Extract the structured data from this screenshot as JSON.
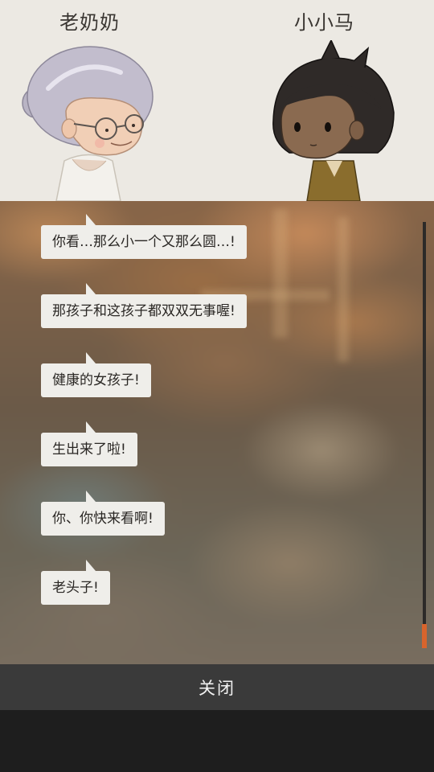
{
  "characters": {
    "left_name": "老奶奶",
    "right_name": "小小马"
  },
  "dialog": [
    "你看…那么小一个又那么圆…!",
    "那孩子和这孩子都双双无事喔!",
    "健康的女孩子!",
    "生出来了啦!",
    "你、你快来看啊!",
    "老头子!"
  ],
  "close_button": "关闭",
  "colors": {
    "header_bg": "#ece9e3",
    "bubble_bg": "#efeeea",
    "close_bar_bg": "#3a3a3a",
    "scroll_thumb": "#d8642c"
  },
  "icons": {
    "grandma_portrait": "grandma-portrait",
    "boy_portrait": "boy-portrait"
  }
}
